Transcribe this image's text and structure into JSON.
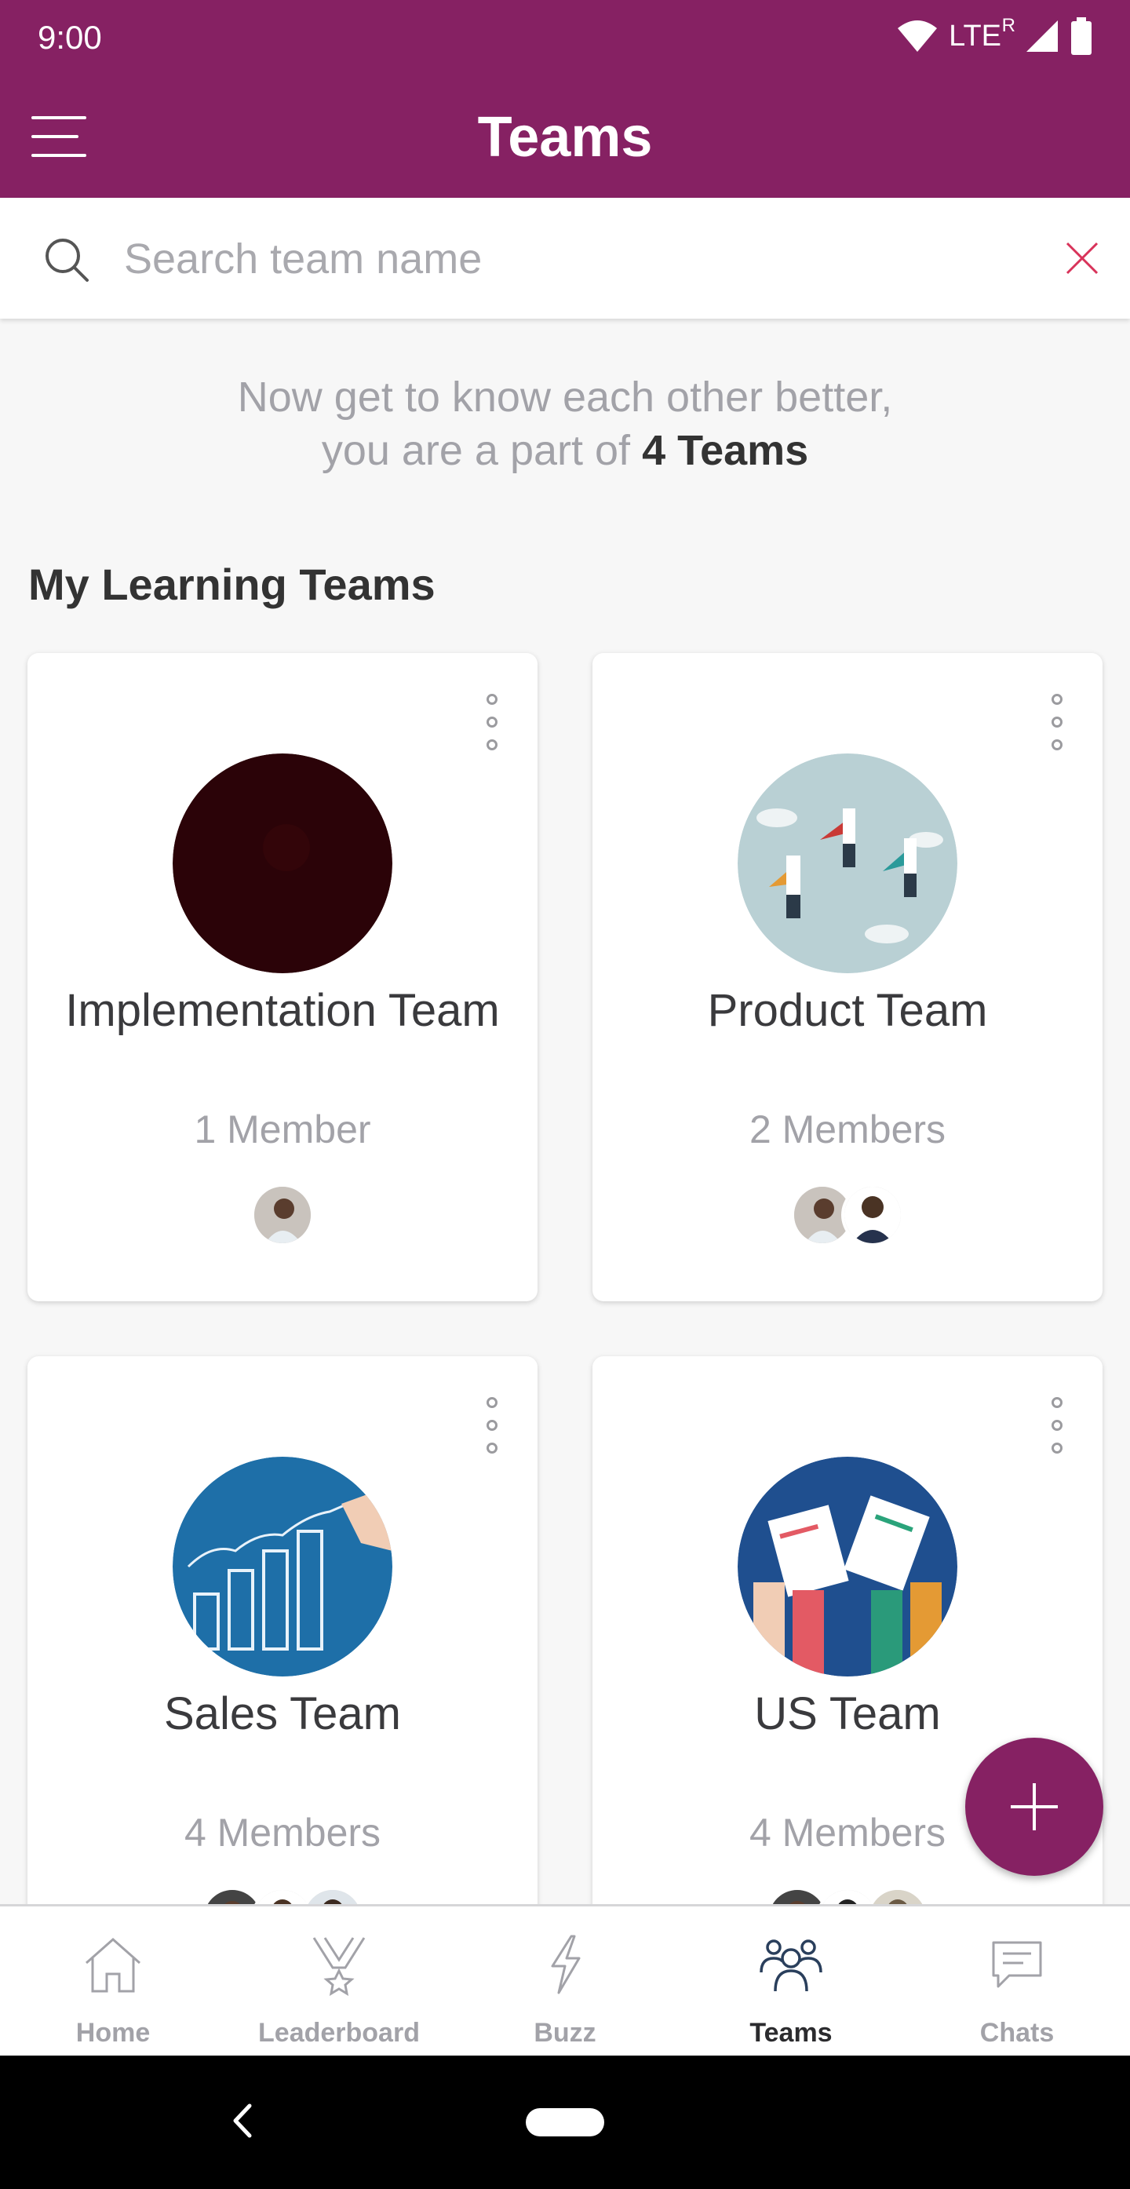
{
  "status_bar": {
    "time": "9:00",
    "network": "LTE",
    "roaming": "R"
  },
  "app_bar": {
    "title": "Teams",
    "menu_icon": "hamburger-menu-icon"
  },
  "search": {
    "placeholder": "Search team name",
    "value": "",
    "clear_icon": "close-icon"
  },
  "intro": {
    "line1": "Now get to know each other better,",
    "line2_prefix": "you are a part of ",
    "line2_bold": "4 Teams"
  },
  "section_title": "My Learning Teams",
  "teams": [
    {
      "name": "Implementation Team",
      "members": "1 Member"
    },
    {
      "name": "Product Team",
      "members": "2 Members"
    },
    {
      "name": "Sales Team",
      "members": "4 Members"
    },
    {
      "name": "US Team",
      "members": "4 Members"
    }
  ],
  "fab": {
    "icon": "plus-icon"
  },
  "bottom_nav": [
    {
      "label": "Home",
      "icon": "home-icon"
    },
    {
      "label": "Leaderboard",
      "icon": "trophy-icon"
    },
    {
      "label": "Buzz",
      "icon": "lightning-icon"
    },
    {
      "label": "Teams",
      "icon": "team-icon",
      "active": true
    },
    {
      "label": "Chats",
      "icon": "chat-icon"
    }
  ],
  "colors": {
    "primary": "#862163",
    "accent_red": "#d8335a",
    "muted_text": "#a2a2a8",
    "dark_text": "#3a3a3d"
  }
}
